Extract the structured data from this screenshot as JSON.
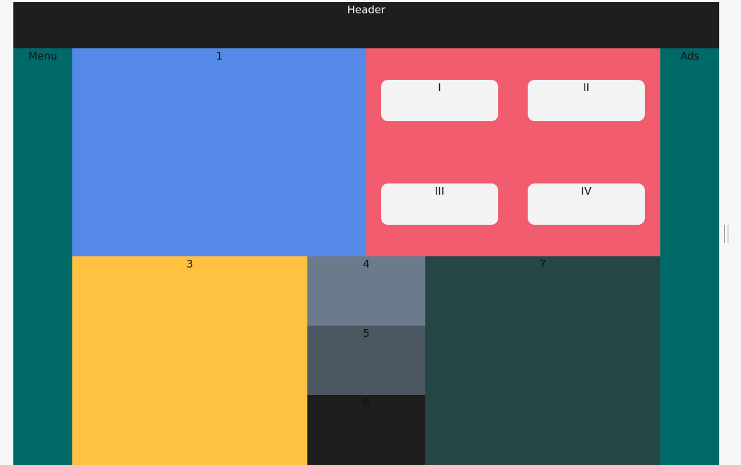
{
  "header": {
    "label": "Header"
  },
  "menu": {
    "label": "Menu"
  },
  "ads": {
    "label": "Ads"
  },
  "boxes": {
    "b1": "1",
    "b3": "3",
    "b4": "4",
    "b5": "5",
    "b6": "6",
    "b7": "7"
  },
  "cards": {
    "c1": "I",
    "c2": "II",
    "c3": "III",
    "c4": "IV"
  },
  "colors": {
    "header": "#1e1e1e",
    "sidebar": "#006a69",
    "box1": "#5589e7",
    "box2": "#f15c6e",
    "box3": "#ffc142",
    "box4": "#6b7b8c",
    "box5": "#4b5862",
    "box6": "#1e1e1e",
    "box7": "#264646",
    "card": "#f3f3f3"
  }
}
